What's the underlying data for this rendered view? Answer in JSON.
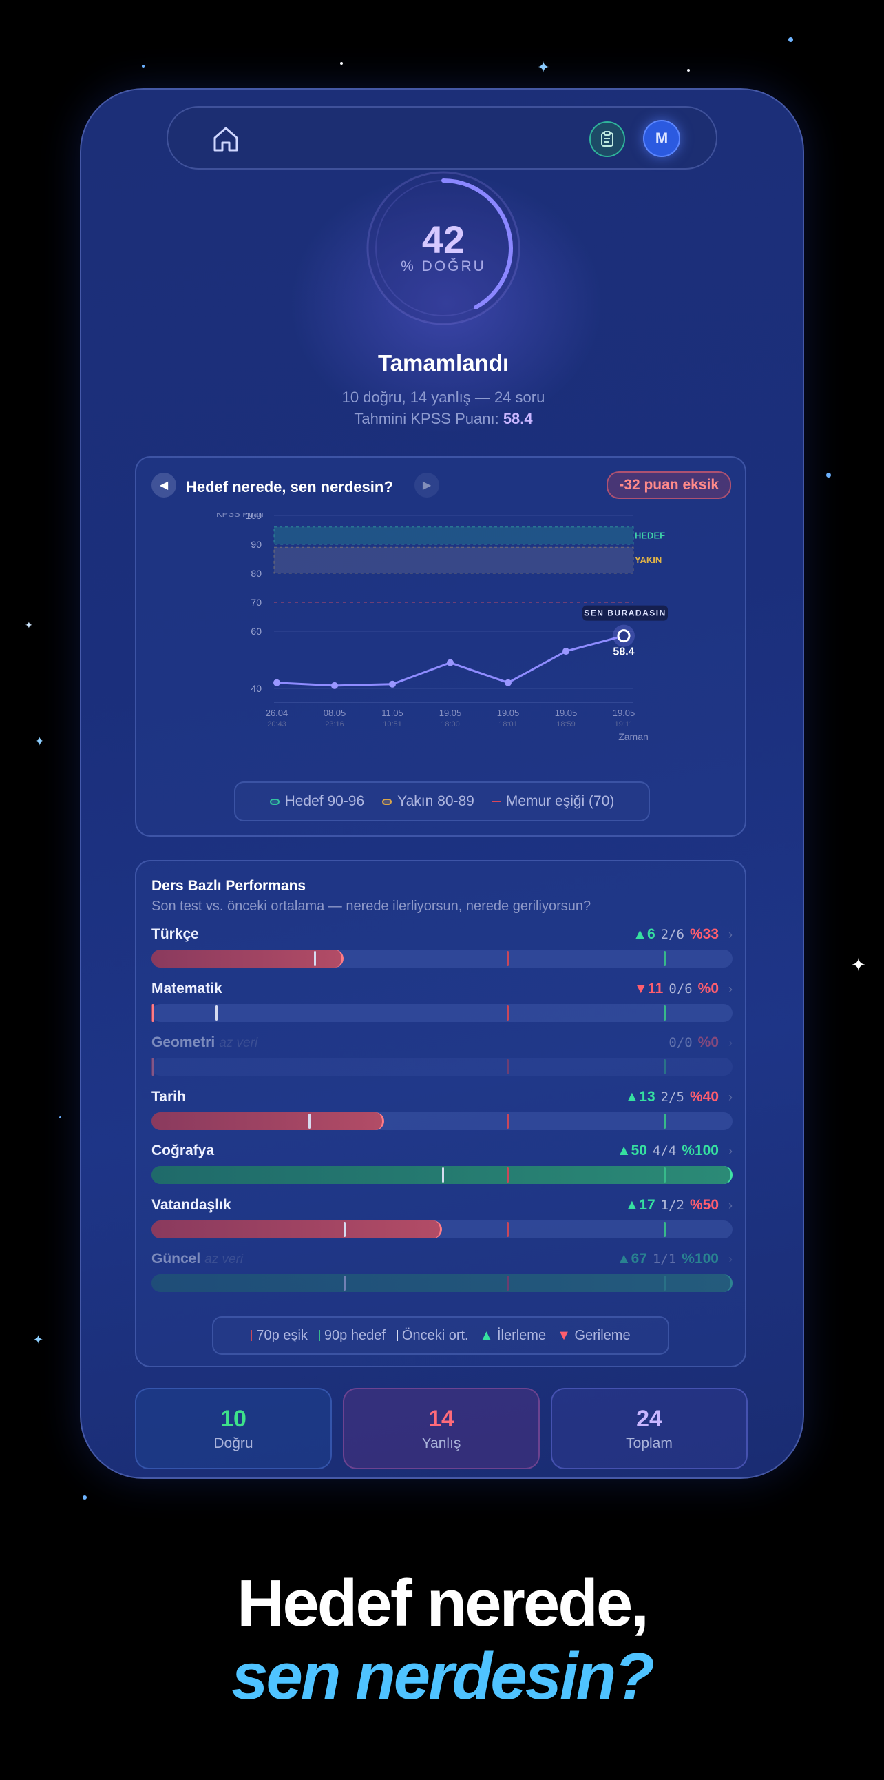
{
  "header": {
    "avatar_initial": "M"
  },
  "score": {
    "value": "42",
    "label": "% DOĞRU",
    "fraction": 0.42
  },
  "status": {
    "title": "Tamamlandı",
    "summary": "10 doğru, 14 yanlış — 24 soru",
    "kpss_label": "Tahmini KPSS Puanı:",
    "kpss_value": "58.4"
  },
  "goal_card": {
    "title": "Hedef nerede, sen nerdesin?",
    "badge": "-32 puan eksik",
    "legend": {
      "target": "Hedef 90-96",
      "near": "Yakın 80-89",
      "threshold": "Memur eşiği (70)"
    }
  },
  "chart_data": {
    "type": "line",
    "ylabel": "KPSS Puan",
    "xlabel": "Zaman",
    "y_ticks": [
      "100",
      "90",
      "80",
      "70",
      "60",
      "40"
    ],
    "bands": {
      "target_label": "HEDEF",
      "near_label": "YAKIN",
      "target_range": [
        90,
        96
      ],
      "near_range": [
        80,
        89
      ],
      "threshold": 70
    },
    "x": [
      {
        "date": "26.04",
        "time": "20:43"
      },
      {
        "date": "08.05",
        "time": "23:16"
      },
      {
        "date": "11.05",
        "time": "10:51"
      },
      {
        "date": "19.05",
        "time": "18:00"
      },
      {
        "date": "19.05",
        "time": "18:01"
      },
      {
        "date": "19.05",
        "time": "18:59"
      },
      {
        "date": "19.05",
        "time": "19:11"
      }
    ],
    "values": [
      42,
      41,
      41.5,
      49,
      42,
      53,
      58.4
    ],
    "current_label": "SEN BURADASIN",
    "current_value": "58.4"
  },
  "performance": {
    "title": "Ders Bazlı Performans",
    "subtitle": "Son test vs. önceki ortalama — nerede ilerliyorsun, nerede geriliyorsun?",
    "low_data_label": "az veri",
    "rows": [
      {
        "name": "Türkçe",
        "delta": "▲6",
        "ratio": "2/6",
        "pct": "%33",
        "fill": 0.33,
        "prev": 0.28,
        "trend": "up",
        "good": false,
        "dim": false
      },
      {
        "name": "Matematik",
        "delta": "▼11",
        "ratio": "0/6",
        "pct": "%0",
        "fill": 0.0,
        "prev": 0.11,
        "trend": "down",
        "good": false,
        "dim": false
      },
      {
        "name": "Geometri",
        "delta": "",
        "ratio": "0/0",
        "pct": "%0",
        "fill": 0.0,
        "prev": null,
        "trend": "",
        "good": false,
        "dim": true
      },
      {
        "name": "Tarih",
        "delta": "▲13",
        "ratio": "2/5",
        "pct": "%40",
        "fill": 0.4,
        "prev": 0.27,
        "trend": "up",
        "good": false,
        "dim": false
      },
      {
        "name": "Coğrafya",
        "delta": "▲50",
        "ratio": "4/4",
        "pct": "%100",
        "fill": 1.0,
        "prev": 0.5,
        "trend": "up",
        "good": true,
        "dim": false
      },
      {
        "name": "Vatandaşlık",
        "delta": "▲17",
        "ratio": "1/2",
        "pct": "%50",
        "fill": 0.5,
        "prev": 0.33,
        "trend": "up",
        "good": false,
        "dim": false
      },
      {
        "name": "Güncel",
        "delta": "▲67",
        "ratio": "1/1",
        "pct": "%100",
        "fill": 1.0,
        "prev": 0.33,
        "trend": "up",
        "good": true,
        "dim": true
      }
    ],
    "legend": {
      "threshold": "70p eşik",
      "target": "90p hedef",
      "prev": "Önceki ort.",
      "up": "İlerleme",
      "down": "Gerileme"
    }
  },
  "totals": [
    {
      "value": "10",
      "label": "Doğru",
      "color": "#3ee28a"
    },
    {
      "value": "14",
      "label": "Yanlış",
      "color": "#ff6b7a"
    },
    {
      "value": "24",
      "label": "Toplam",
      "color": "#c9b6ff"
    }
  ],
  "hero": {
    "line1": "Hedef nerede,",
    "line2": "sen nerdesin?"
  }
}
